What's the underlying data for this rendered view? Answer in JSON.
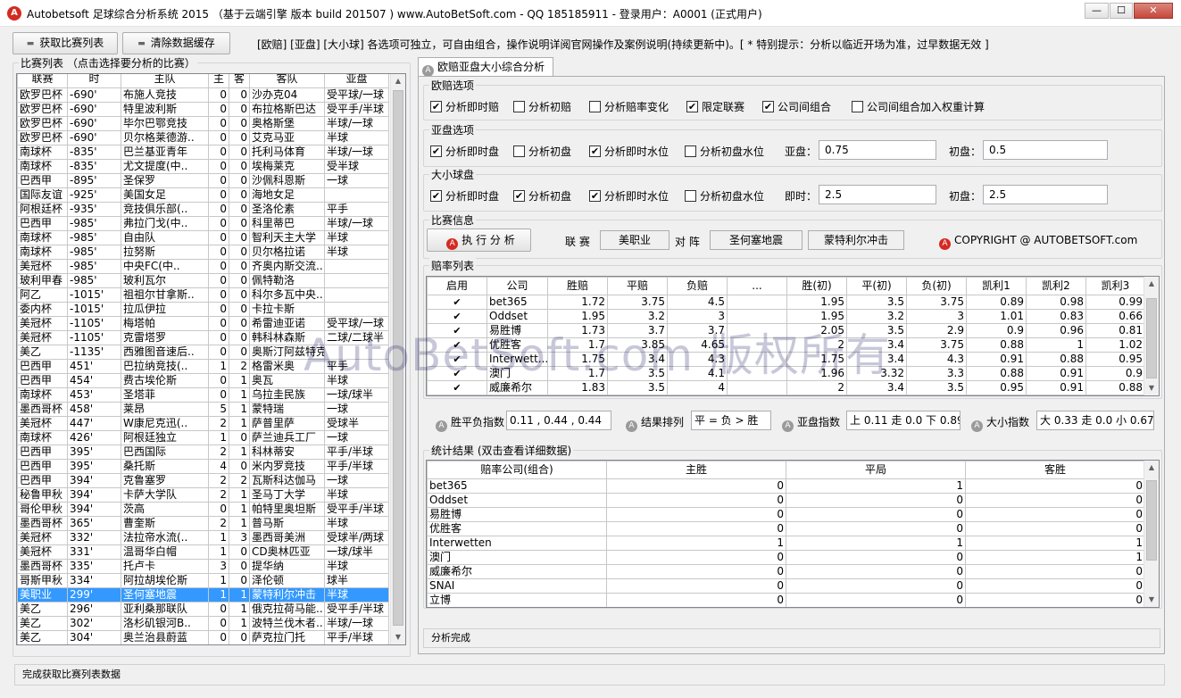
{
  "window": {
    "title": "Autobetsoft 足球综合分析系统 2015 （基于云端引擎 版本 build 201507 ) www.AutoBetSoft.com  - QQ 185185911  - 登录用户：A0001 (正式用户)",
    "app_icon": "A",
    "min_label": "—",
    "max_label": "☐",
    "close_label": "✕"
  },
  "toolbar": {
    "fetch_label": "获取比赛列表",
    "clear_label": "清除数据缓存",
    "note": "[欧赔] [亚盘] [大小球] 各选项可独立，可自由组合，操作说明详阅官网操作及案例说明(持续更新中)。[ * 特别提示：分析以临近开场为准，过早数据无效 ]"
  },
  "match_list": {
    "title": "比赛列表 （点击选择要分析的比赛）",
    "columns": [
      "联赛",
      "时",
      "主队",
      "主",
      "客",
      "客队",
      "亚盘"
    ],
    "rows": [
      [
        "欧罗巴杯",
        "-690'",
        "布施人竞技",
        "0",
        "0",
        "沙办克04",
        "受平球/一球"
      ],
      [
        "欧罗巴杯",
        "-690'",
        "特里波利斯",
        "0",
        "0",
        "布拉格斯巴达",
        "受平手/半球"
      ],
      [
        "欧罗巴杯",
        "-690'",
        "毕尔巴鄂竞技",
        "0",
        "0",
        "奥格斯堡",
        "半球/一球"
      ],
      [
        "欧罗巴杯",
        "-690'",
        "贝尔格莱德游..",
        "0",
        "0",
        "艾克马亚",
        "半球"
      ],
      [
        "南球杯",
        "-835'",
        "巴兰基亚青年",
        "0",
        "0",
        "托利马体育",
        "半球/一球"
      ],
      [
        "南球杯",
        "-835'",
        "尤文提度(中..",
        "0",
        "0",
        "埃梅莱克",
        "受半球"
      ],
      [
        "巴西甲",
        "-895'",
        "圣保罗",
        "0",
        "0",
        "沙佩科恩斯",
        "一球"
      ],
      [
        "国际友谊",
        "-925'",
        "美国女足",
        "0",
        "0",
        "海地女足",
        ""
      ],
      [
        "阿根廷杯",
        "-935'",
        "竞技俱乐部(..",
        "0",
        "0",
        "圣洛伦素",
        "平手"
      ],
      [
        "巴西甲",
        "-985'",
        "弗拉门戈(中..",
        "0",
        "0",
        "科里蒂巴",
        "半球/一球"
      ],
      [
        "南球杯",
        "-985'",
        "自由队",
        "0",
        "0",
        "智利天主大学",
        "半球"
      ],
      [
        "南球杯",
        "-985'",
        "拉努斯",
        "0",
        "0",
        "贝尔格拉诺",
        "半球"
      ],
      [
        "美冠杯",
        "-985'",
        "中央FC(中..",
        "0",
        "0",
        "齐奥内斯交流..",
        ""
      ],
      [
        "玻利甲春",
        "-985'",
        "玻利瓦尔",
        "0",
        "0",
        "佩特勒洛",
        ""
      ],
      [
        "阿乙",
        "-1015'",
        "祖祖尔甘拿斯..",
        "0",
        "0",
        "科尔多瓦中央..",
        ""
      ],
      [
        "委内杯",
        "-1015'",
        "拉瓜伊拉",
        "0",
        "0",
        "卡拉卡斯",
        ""
      ],
      [
        "美冠杯",
        "-1105'",
        "梅塔帕",
        "0",
        "0",
        "希雷迪亚诺",
        "受平球/一球"
      ],
      [
        "美冠杯",
        "-1105'",
        "克雷塔罗",
        "0",
        "0",
        "韩科林森斯",
        "二球/二球半"
      ],
      [
        "美乙",
        "-1135'",
        "西雅图音速后..",
        "0",
        "0",
        "奥斯汀阿兹特克",
        ""
      ],
      [
        "巴西甲",
        "451'",
        "巴拉纳竞技(..",
        "1",
        "2",
        "格雷米奥",
        "平手"
      ],
      [
        "巴西甲",
        "454'",
        "费古埃伦斯",
        "0",
        "1",
        "奥瓦",
        "半球"
      ],
      [
        "南球杯",
        "453'",
        "圣塔菲",
        "0",
        "1",
        "乌拉圭民族",
        "一球/球半"
      ],
      [
        "墨西哥杯",
        "458'",
        "莱昂",
        "5",
        "1",
        "蒙特瑞",
        "一球"
      ],
      [
        "美冠杯",
        "447'",
        "W康尼克迅(..",
        "2",
        "1",
        "萨普里萨",
        "受球半"
      ],
      [
        "南球杯",
        "426'",
        "阿根廷独立",
        "1",
        "0",
        "萨兰迪兵工厂",
        "一球"
      ],
      [
        "巴西甲",
        "395'",
        "巴西国际",
        "2",
        "1",
        "科林蒂安",
        "平手/半球"
      ],
      [
        "巴西甲",
        "395'",
        "桑托斯",
        "4",
        "0",
        "米内罗竞技",
        "平手/半球"
      ],
      [
        "巴西甲",
        "394'",
        "克鲁塞罗",
        "2",
        "2",
        "瓦斯科达伽马",
        "一球"
      ],
      [
        "秘鲁甲秋",
        "394'",
        "卡萨大学队",
        "2",
        "1",
        "圣马丁大学",
        "半球"
      ],
      [
        "哥伦甲秋",
        "394'",
        "茨高",
        "0",
        "1",
        "帕特里奥坦斯",
        "受平手/半球"
      ],
      [
        "墨西哥杯",
        "365'",
        "曹奎斯",
        "2",
        "1",
        "普马斯",
        "半球"
      ],
      [
        "美冠杯",
        "332'",
        "法拉帝水流(..",
        "1",
        "3",
        "墨西哥美洲",
        "受球半/两球"
      ],
      [
        "美冠杯",
        "331'",
        "温哥华白帽",
        "1",
        "0",
        "CD奥林匹亚",
        "一球/球半"
      ],
      [
        "墨西哥杯",
        "335'",
        "托卢卡",
        "3",
        "0",
        "提华纳",
        "半球"
      ],
      [
        "哥斯甲秋",
        "334'",
        "阿拉胡埃伦斯",
        "1",
        "0",
        "泽伦顿",
        "球半"
      ],
      [
        "美职业",
        "299'",
        "圣何塞地震",
        "1",
        "1",
        "蒙特利尔冲击",
        "半球"
      ],
      [
        "美乙",
        "296'",
        "亚利桑那联队",
        "0",
        "1",
        "俄克拉荷马能..",
        "受平手/半球"
      ],
      [
        "美乙",
        "302'",
        "洛杉矶银河B..",
        "0",
        "1",
        "波特兰伐木者..",
        "半球/一球"
      ],
      [
        "美乙",
        "304'",
        "奥兰治县蔚蓝",
        "0",
        "0",
        "萨克拉门托",
        "平手/半球"
      ]
    ]
  },
  "tab": {
    "label": "欧赔亚盘大小综合分析"
  },
  "europe": {
    "title": "欧赔选项",
    "options": [
      {
        "label": "分析即时赔",
        "checked": "✔"
      },
      {
        "label": "分析初赔",
        "checked": ""
      },
      {
        "label": "分析赔率变化",
        "checked": ""
      },
      {
        "label": "限定联赛",
        "checked": "✔"
      },
      {
        "label": "公司间组合",
        "checked": "✔"
      },
      {
        "label": "公司间组合加入权重计算",
        "checked": ""
      }
    ]
  },
  "asian": {
    "title": "亚盘选项",
    "options": [
      {
        "label": "分析即时盘",
        "checked": "✔"
      },
      {
        "label": "分析初盘",
        "checked": ""
      },
      {
        "label": "分析即时水位",
        "checked": "✔"
      },
      {
        "label": "分析初盘水位",
        "checked": ""
      }
    ],
    "current_label": "亚盘：",
    "current_value": "0.75",
    "initial_label": "初盘：",
    "initial_value": "0.5"
  },
  "overunder": {
    "title": "大小球盘",
    "options": [
      {
        "label": "分析即时盘",
        "checked": "✔"
      },
      {
        "label": "分析初盘",
        "checked": "✔"
      },
      {
        "label": "分析即时水位",
        "checked": "✔"
      },
      {
        "label": "分析初盘水位",
        "checked": ""
      }
    ],
    "current_label": "即时：",
    "current_value": "2.5",
    "initial_label": "初盘：",
    "initial_value": "2.5"
  },
  "match_info": {
    "title": "比赛信息",
    "run_label": "执 行 分 析",
    "league_label": "联 赛",
    "league_value": "美职业",
    "vs_label": "对 阵",
    "home": "圣何塞地震",
    "away": "蒙特利尔冲击",
    "copyright": "COPYRIGHT @ AUTOBETSOFT.com"
  },
  "odds": {
    "title": "赔率列表",
    "columns": [
      "启用",
      "公司",
      "胜赔",
      "平赔",
      "负赔",
      "...",
      "胜(初)",
      "平(初)",
      "负(初)",
      "凯利1",
      "凯利2",
      "凯利3"
    ],
    "rows": [
      [
        "✔",
        "bet365",
        "1.72",
        "3.75",
        "4.5",
        "",
        "1.95",
        "3.5",
        "3.75",
        "0.89",
        "0.98",
        "0.99"
      ],
      [
        "✔",
        "Oddset",
        "1.95",
        "3.2",
        "3",
        "",
        "1.95",
        "3.2",
        "3",
        "1.01",
        "0.83",
        "0.66"
      ],
      [
        "✔",
        "易胜博",
        "1.73",
        "3.7",
        "3.7",
        "",
        "2.05",
        "3.5",
        "2.9",
        "0.9",
        "0.96",
        "0.81"
      ],
      [
        "✔",
        "优胜客",
        "1.7",
        "3.85",
        "4.65",
        "",
        "2",
        "3.4",
        "3.75",
        "0.88",
        "1",
        "1.02"
      ],
      [
        "✔",
        "Interwett...",
        "1.75",
        "3.4",
        "4.3",
        "",
        "1.75",
        "3.4",
        "4.3",
        "0.91",
        "0.88",
        "0.95"
      ],
      [
        "✔",
        "澳门",
        "1.7",
        "3.5",
        "4.1",
        "",
        "1.96",
        "3.32",
        "3.3",
        "0.88",
        "0.91",
        "0.9"
      ],
      [
        "✔",
        "威廉希尔",
        "1.83",
        "3.5",
        "4",
        "",
        "2",
        "3.4",
        "3.5",
        "0.95",
        "0.91",
        "0.88"
      ]
    ]
  },
  "indices": {
    "wdl_label": "胜平负指数",
    "wdl_value": "0.11 , 0.44 , 0.44",
    "order_label": "结果排列",
    "order_value": "平 = 负 > 胜",
    "asian_label": "亚盘指数",
    "asian_value": "上 0.11 走 0.0 下 0.89",
    "ou_label": "大小指数",
    "ou_value": "大 0.33 走 0.0 小 0.67"
  },
  "stats": {
    "title": "统计结果 (双击查看详细数据)",
    "columns": [
      "赔率公司(组合)",
      "主胜",
      "平局",
      "客胜"
    ],
    "rows": [
      [
        "bet365",
        "0",
        "1",
        "0"
      ],
      [
        "Oddset",
        "0",
        "0",
        "0"
      ],
      [
        "易胜博",
        "0",
        "0",
        "0"
      ],
      [
        "优胜客",
        "0",
        "0",
        "0"
      ],
      [
        "Interwetten",
        "1",
        "1",
        "1"
      ],
      [
        "澳门",
        "0",
        "0",
        "1"
      ],
      [
        "威廉希尔",
        "0",
        "0",
        "0"
      ],
      [
        "SNAI",
        "0",
        "0",
        "0"
      ],
      [
        "立博",
        "0",
        "0",
        "0"
      ]
    ]
  },
  "status": {
    "panel": "分析完成",
    "bottom": "完成获取比赛列表数据"
  },
  "watermark": "AutoBetSoft.com 版权所有",
  "colors": {
    "selection": "#3399ff",
    "close_button": "#c7473a",
    "icon_red": "#d32a22"
  }
}
